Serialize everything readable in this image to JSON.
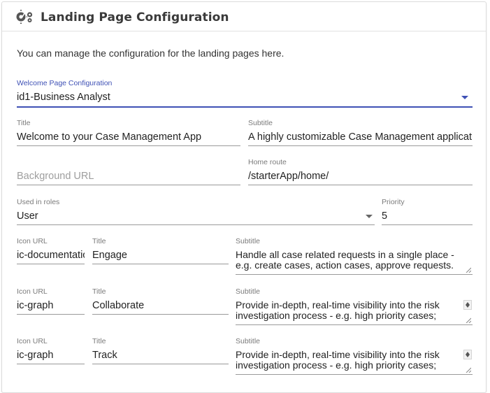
{
  "header": {
    "title": "Landing Page Configuration",
    "icon": "gears-icon"
  },
  "intro": "You can manage the configuration for the landing pages here.",
  "welcome_config": {
    "label": "Welcome Page Configuration",
    "value": "id1-Business Analyst"
  },
  "title_field": {
    "label": "Title",
    "value": "Welcome to your Case Management App"
  },
  "subtitle_field": {
    "label": "Subtitle",
    "value": "A highly customizable Case Management application"
  },
  "background_url": {
    "placeholder": "Background URL"
  },
  "home_route": {
    "label": "Home route",
    "value": "/starterApp/home/"
  },
  "used_in_roles": {
    "label": "Used in roles",
    "value": "User"
  },
  "priority": {
    "label": "Priority",
    "value": "5"
  },
  "highlights": [
    {
      "icon_label": "Icon URL",
      "icon_value": "ic-documentation",
      "title_label": "Title",
      "title_value": "Engage",
      "subtitle_label": "Subtitle",
      "subtitle_value": "Handle all case related requests in a single place - e.g. create cases, action cases, approve requests."
    },
    {
      "icon_label": "Icon URL",
      "icon_value": "ic-graph",
      "title_label": "Title",
      "title_value": "Collaborate",
      "subtitle_label": "Subtitle",
      "subtitle_value": "Provide in-depth, real-time visibility into the risk investigation process - e.g. high priority cases;"
    },
    {
      "icon_label": "Icon URL",
      "icon_value": "ic-graph",
      "title_label": "Title",
      "title_value": "Track",
      "subtitle_label": "Subtitle",
      "subtitle_value": "Provide in-depth, real-time visibility into the risk investigation process - e.g. high priority cases;"
    }
  ],
  "colors": {
    "accent": "#3f51b5",
    "label": "#7a7a7a",
    "text": "#222222"
  }
}
